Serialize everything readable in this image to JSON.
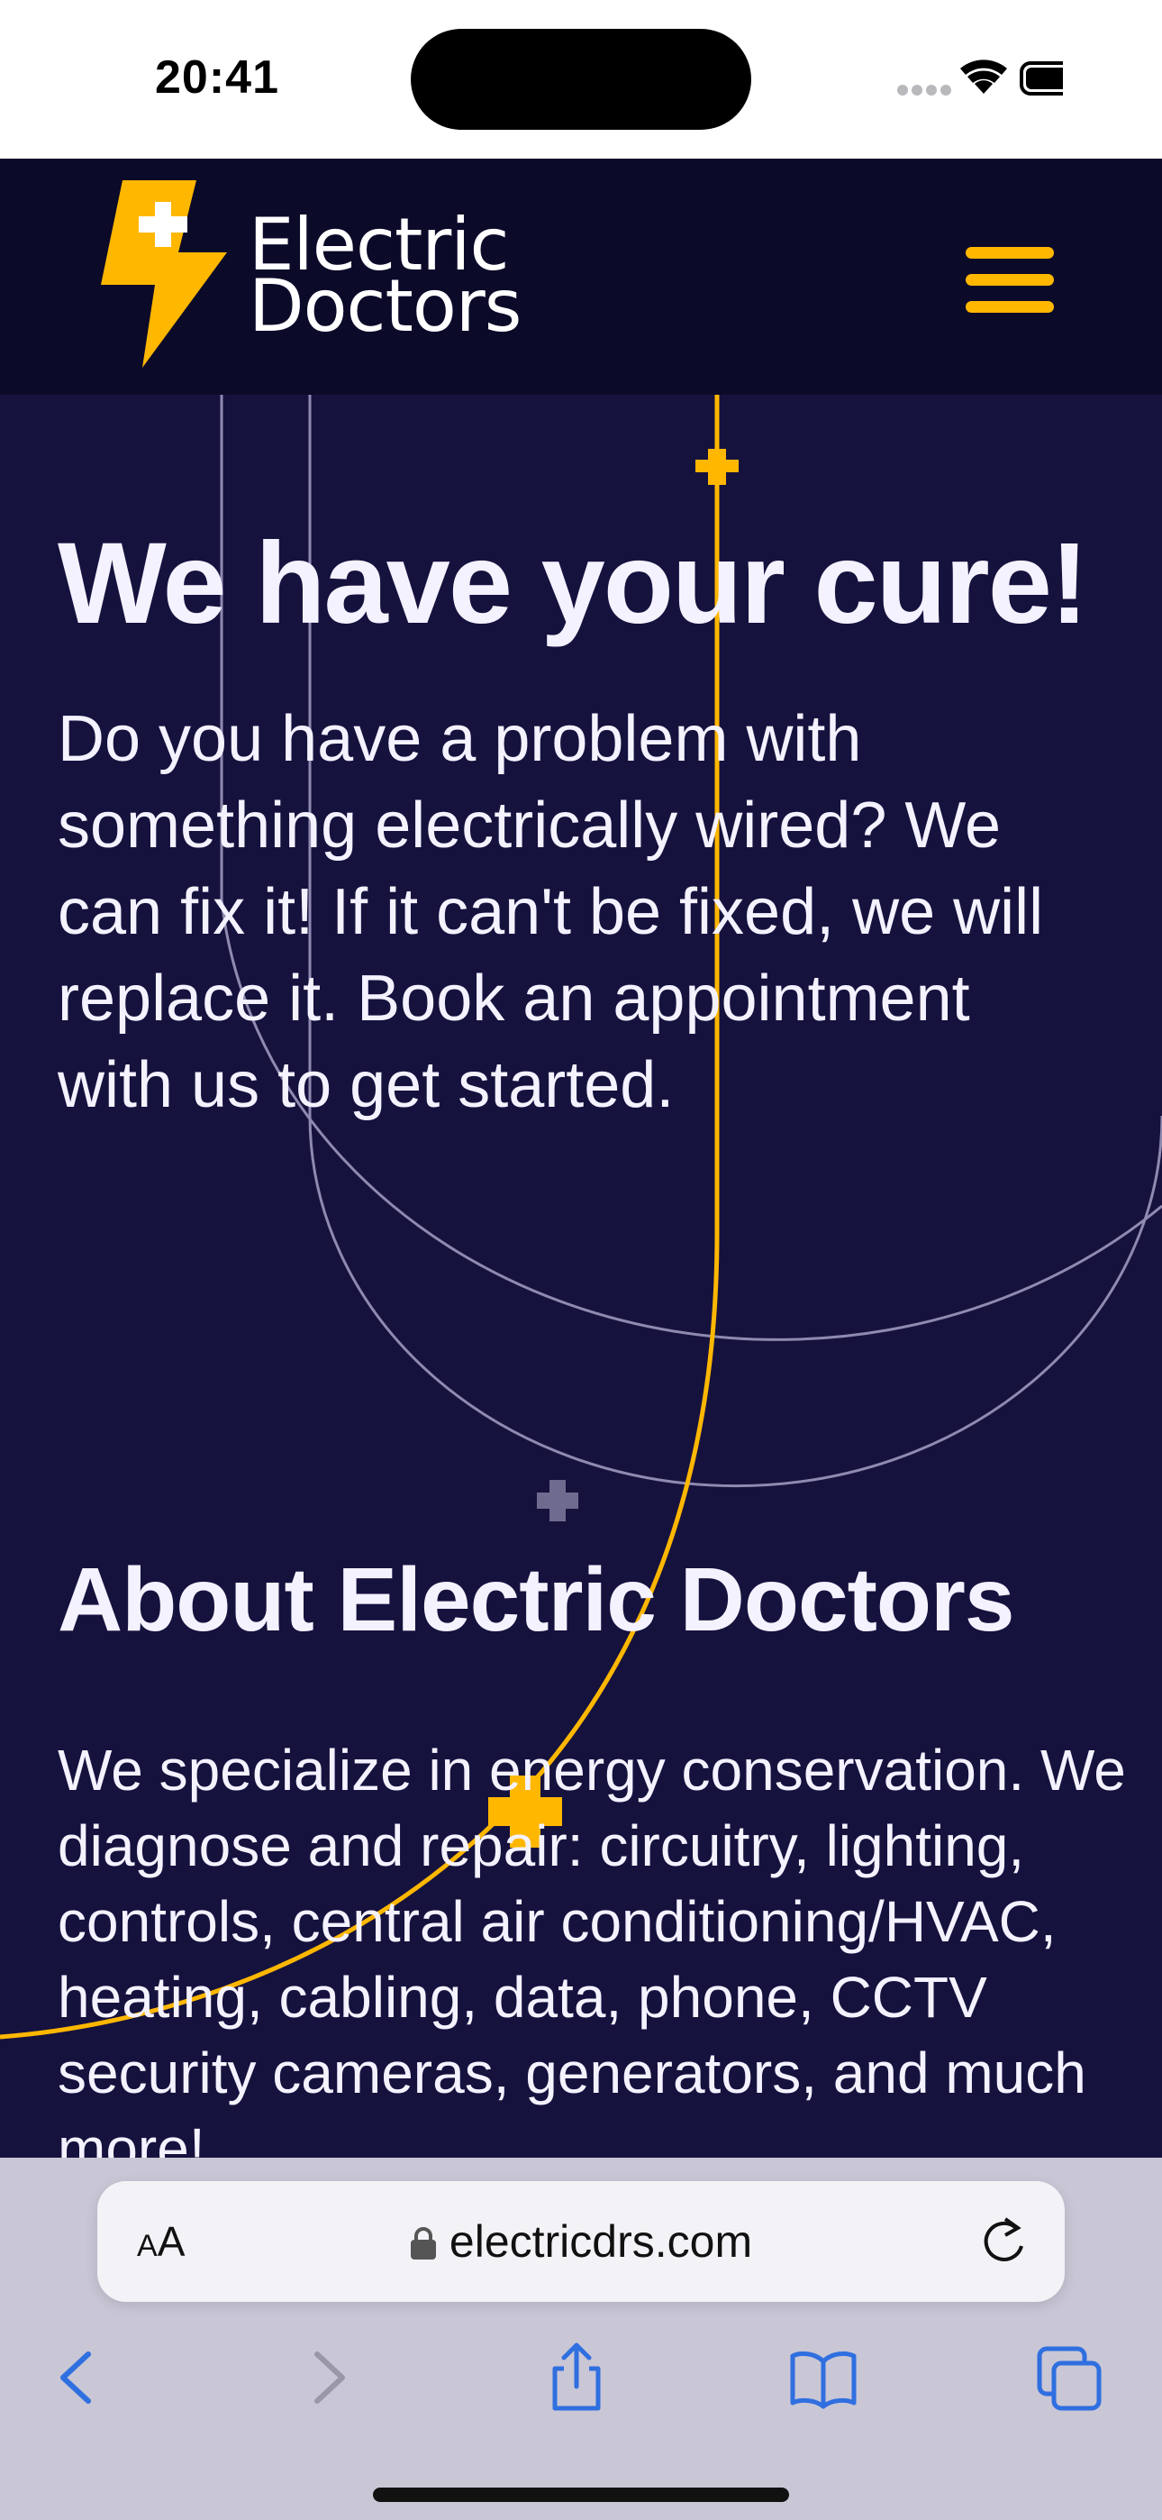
{
  "status_bar": {
    "time": "20:41"
  },
  "header": {
    "logo_line1": "Electric",
    "logo_line2": "Doctors"
  },
  "hero": {
    "title": "We have your cure!",
    "text": "Do you have a problem with something electrically wired? We can fix it! If it can't be fixed, we will replace it. Book an appointment with us to get started."
  },
  "about": {
    "title": "About Electric Doctors",
    "text": "We specialize in energy conservation. We diagnose and repair: circuitry, lighting, controls, central air conditioning/HVAC, heating, cabling, data, phone, CCTV security cameras, generators, and much more!"
  },
  "browser": {
    "aa_large": "A",
    "aa_small": "A",
    "url": "electricdrs.com"
  },
  "colors": {
    "accent": "#ffb700",
    "header_bg": "#0c0a29",
    "page_bg": "#16123e",
    "text": "#f4f2ff"
  }
}
